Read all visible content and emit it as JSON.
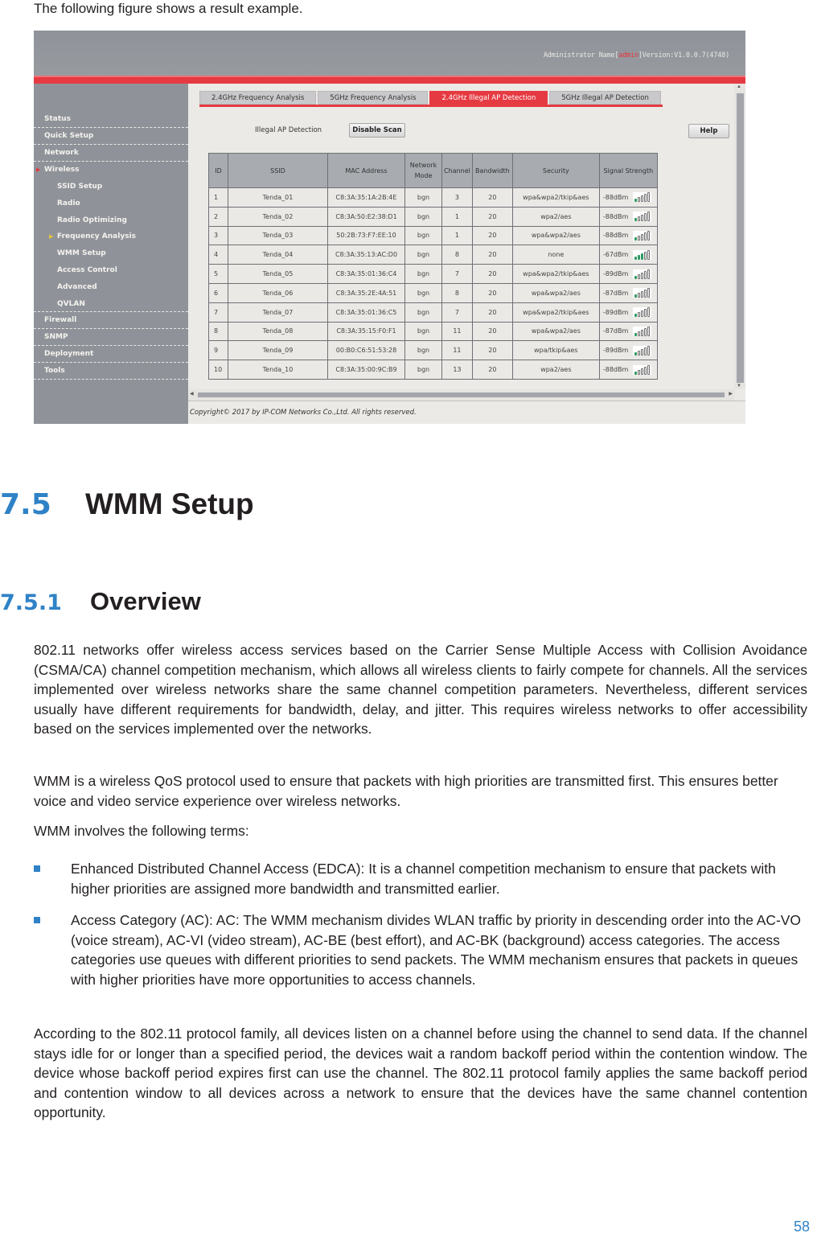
{
  "intro_text": "The following figure shows a result example.",
  "figure": {
    "admin_prefix": "Administrator Name[",
    "admin_name": "admin",
    "admin_suffix": "]Version:V1.0.0.7(4748)",
    "sidebar": {
      "items": [
        {
          "label": "Status",
          "level": "top"
        },
        {
          "label": "Quick Setup",
          "level": "top"
        },
        {
          "label": "Network",
          "level": "top"
        },
        {
          "label": "Wireless",
          "level": "top",
          "expanded": true
        },
        {
          "label": "SSID Setup",
          "level": "sub"
        },
        {
          "label": "Radio",
          "level": "sub"
        },
        {
          "label": "Radio Optimizing",
          "level": "sub"
        },
        {
          "label": "Frequency Analysis",
          "level": "sub",
          "selected": true
        },
        {
          "label": "WMM Setup",
          "level": "sub"
        },
        {
          "label": "Access Control",
          "level": "sub"
        },
        {
          "label": "Advanced",
          "level": "sub"
        },
        {
          "label": "QVLAN",
          "level": "sub"
        },
        {
          "label": "Firewall",
          "level": "top"
        },
        {
          "label": "SNMP",
          "level": "top"
        },
        {
          "label": "Deployment",
          "level": "top"
        },
        {
          "label": "Tools",
          "level": "top"
        }
      ],
      "arrow_glyph": "▶"
    },
    "tabs": [
      {
        "label": "2.4GHz Frequency Analysis",
        "active": false
      },
      {
        "label": "5GHz Frequency Analysis",
        "active": false
      },
      {
        "label": "2.4GHz Illegal AP Detection",
        "active": true
      },
      {
        "label": "5GHz Illegal AP Detection",
        "active": false
      }
    ],
    "illegal_ap_label": "Illegal AP Detection",
    "disable_scan_label": "Disable Scan",
    "help_label": "Help",
    "table": {
      "headers": [
        "ID",
        "SSID",
        "MAC Address",
        "Network Mode",
        "Channel",
        "Bandwidth",
        "Security",
        "Signal Strength"
      ],
      "rows": [
        {
          "id": "1",
          "ssid": "Tenda_01",
          "mac": "C8:3A:35:1A:2B:4E",
          "mode": "bgn",
          "channel": "3",
          "bandwidth": "20",
          "security": "wpa&wpa2/tkip&aes",
          "signal": "-88dBm",
          "bars": 1
        },
        {
          "id": "2",
          "ssid": "Tenda_02",
          "mac": "C8:3A:50:E2:38:D1",
          "mode": "bgn",
          "channel": "1",
          "bandwidth": "20",
          "security": "wpa2/aes",
          "signal": "-88dBm",
          "bars": 1
        },
        {
          "id": "3",
          "ssid": "Tenda_03",
          "mac": "50:2B:73:F7:EE:10",
          "mode": "bgn",
          "channel": "1",
          "bandwidth": "20",
          "security": "wpa&wpa2/aes",
          "signal": "-88dBm",
          "bars": 1
        },
        {
          "id": "4",
          "ssid": "Tenda_04",
          "mac": "C8:3A:35:13:AC:D0",
          "mode": "bgn",
          "channel": "8",
          "bandwidth": "20",
          "security": "none",
          "signal": "-67dBm",
          "bars": 3
        },
        {
          "id": "5",
          "ssid": "Tenda_05",
          "mac": "C8:3A:35:01:36:C4",
          "mode": "bgn",
          "channel": "7",
          "bandwidth": "20",
          "security": "wpa&wpa2/tkip&aes",
          "signal": "-89dBm",
          "bars": 1
        },
        {
          "id": "6",
          "ssid": "Tenda_06",
          "mac": "C8:3A:35:2E:4A:51",
          "mode": "bgn",
          "channel": "8",
          "bandwidth": "20",
          "security": "wpa&wpa2/aes",
          "signal": "-87dBm",
          "bars": 1
        },
        {
          "id": "7",
          "ssid": "Tenda_07",
          "mac": "C8:3A:35:01:36:C5",
          "mode": "bgn",
          "channel": "7",
          "bandwidth": "20",
          "security": "wpa&wpa2/tkip&aes",
          "signal": "-89dBm",
          "bars": 1
        },
        {
          "id": "8",
          "ssid": "Tenda_08",
          "mac": "C8:3A:35:15:F0:F1",
          "mode": "bgn",
          "channel": "11",
          "bandwidth": "20",
          "security": "wpa&wpa2/aes",
          "signal": "-87dBm",
          "bars": 1
        },
        {
          "id": "9",
          "ssid": "Tenda_09",
          "mac": "00:B0:C6:51:53:28",
          "mode": "bgn",
          "channel": "11",
          "bandwidth": "20",
          "security": "wpa/tkip&aes",
          "signal": "-89dBm",
          "bars": 1
        },
        {
          "id": "10",
          "ssid": "Tenda_10",
          "mac": "C8:3A:35:00:9C:B9",
          "mode": "bgn",
          "channel": "13",
          "bandwidth": "20",
          "security": "wpa2/aes",
          "signal": "-88dBm",
          "bars": 1
        }
      ]
    },
    "copyright": "Copyright© 2017 by IP-COM Networks Co.,Ltd. All rights reserved.",
    "colors": {
      "accent_red": "#e63a42",
      "signal_green": "#2f9a63"
    }
  },
  "section": {
    "number": "7.5",
    "title": "WMM Setup"
  },
  "subsection": {
    "number": "7.5.1",
    "title": "Overview"
  },
  "paragraphs": [
    "802.11 networks offer wireless access services based on the Carrier Sense Multiple Access with Collision Avoidance (CSMA/CA) channel competition mechanism, which allows all wireless clients to fairly compete for channels. All the services implemented over wireless networks share the same channel competition parameters. Nevertheless, different services usually have different requirements for bandwidth, delay, and jitter. This requires wireless networks to offer accessibility based on the services implemented over the networks.",
    "WMM is a wireless QoS protocol used to ensure that packets with high priorities are transmitted first. This ensures better voice and video service experience over wireless networks.",
    "WMM involves the following terms:",
    "According to the 802.11 protocol family, all devices listen on a channel before using the channel to send data. If the channel stays idle for or longer than a specified period, the devices wait a random backoff period within the contention window. The device whose backoff period expires first can use the channel. The 802.11 protocol family applies the same backoff period and contention window to all devices across a network to ensure that the devices have the same channel contention opportunity."
  ],
  "bullets": [
    "Enhanced Distributed Channel Access (EDCA): It is a channel competition mechanism to ensure that packets with higher priorities are assigned more bandwidth and transmitted earlier.",
    "Access Category (AC): AC: The WMM mechanism divides WLAN traffic by priority in descending order into the AC-VO (voice stream), AC-VI (video stream), AC-BE (best effort), and AC-BK (background) access categories. The access categories use queues with different priorities to send packets. The WMM mechanism ensures that packets in queues with higher priorities have more opportunities to access channels."
  ],
  "page_number": "58",
  "colors": {
    "heading_blue": "#2f82c6",
    "text": "#231f20"
  }
}
